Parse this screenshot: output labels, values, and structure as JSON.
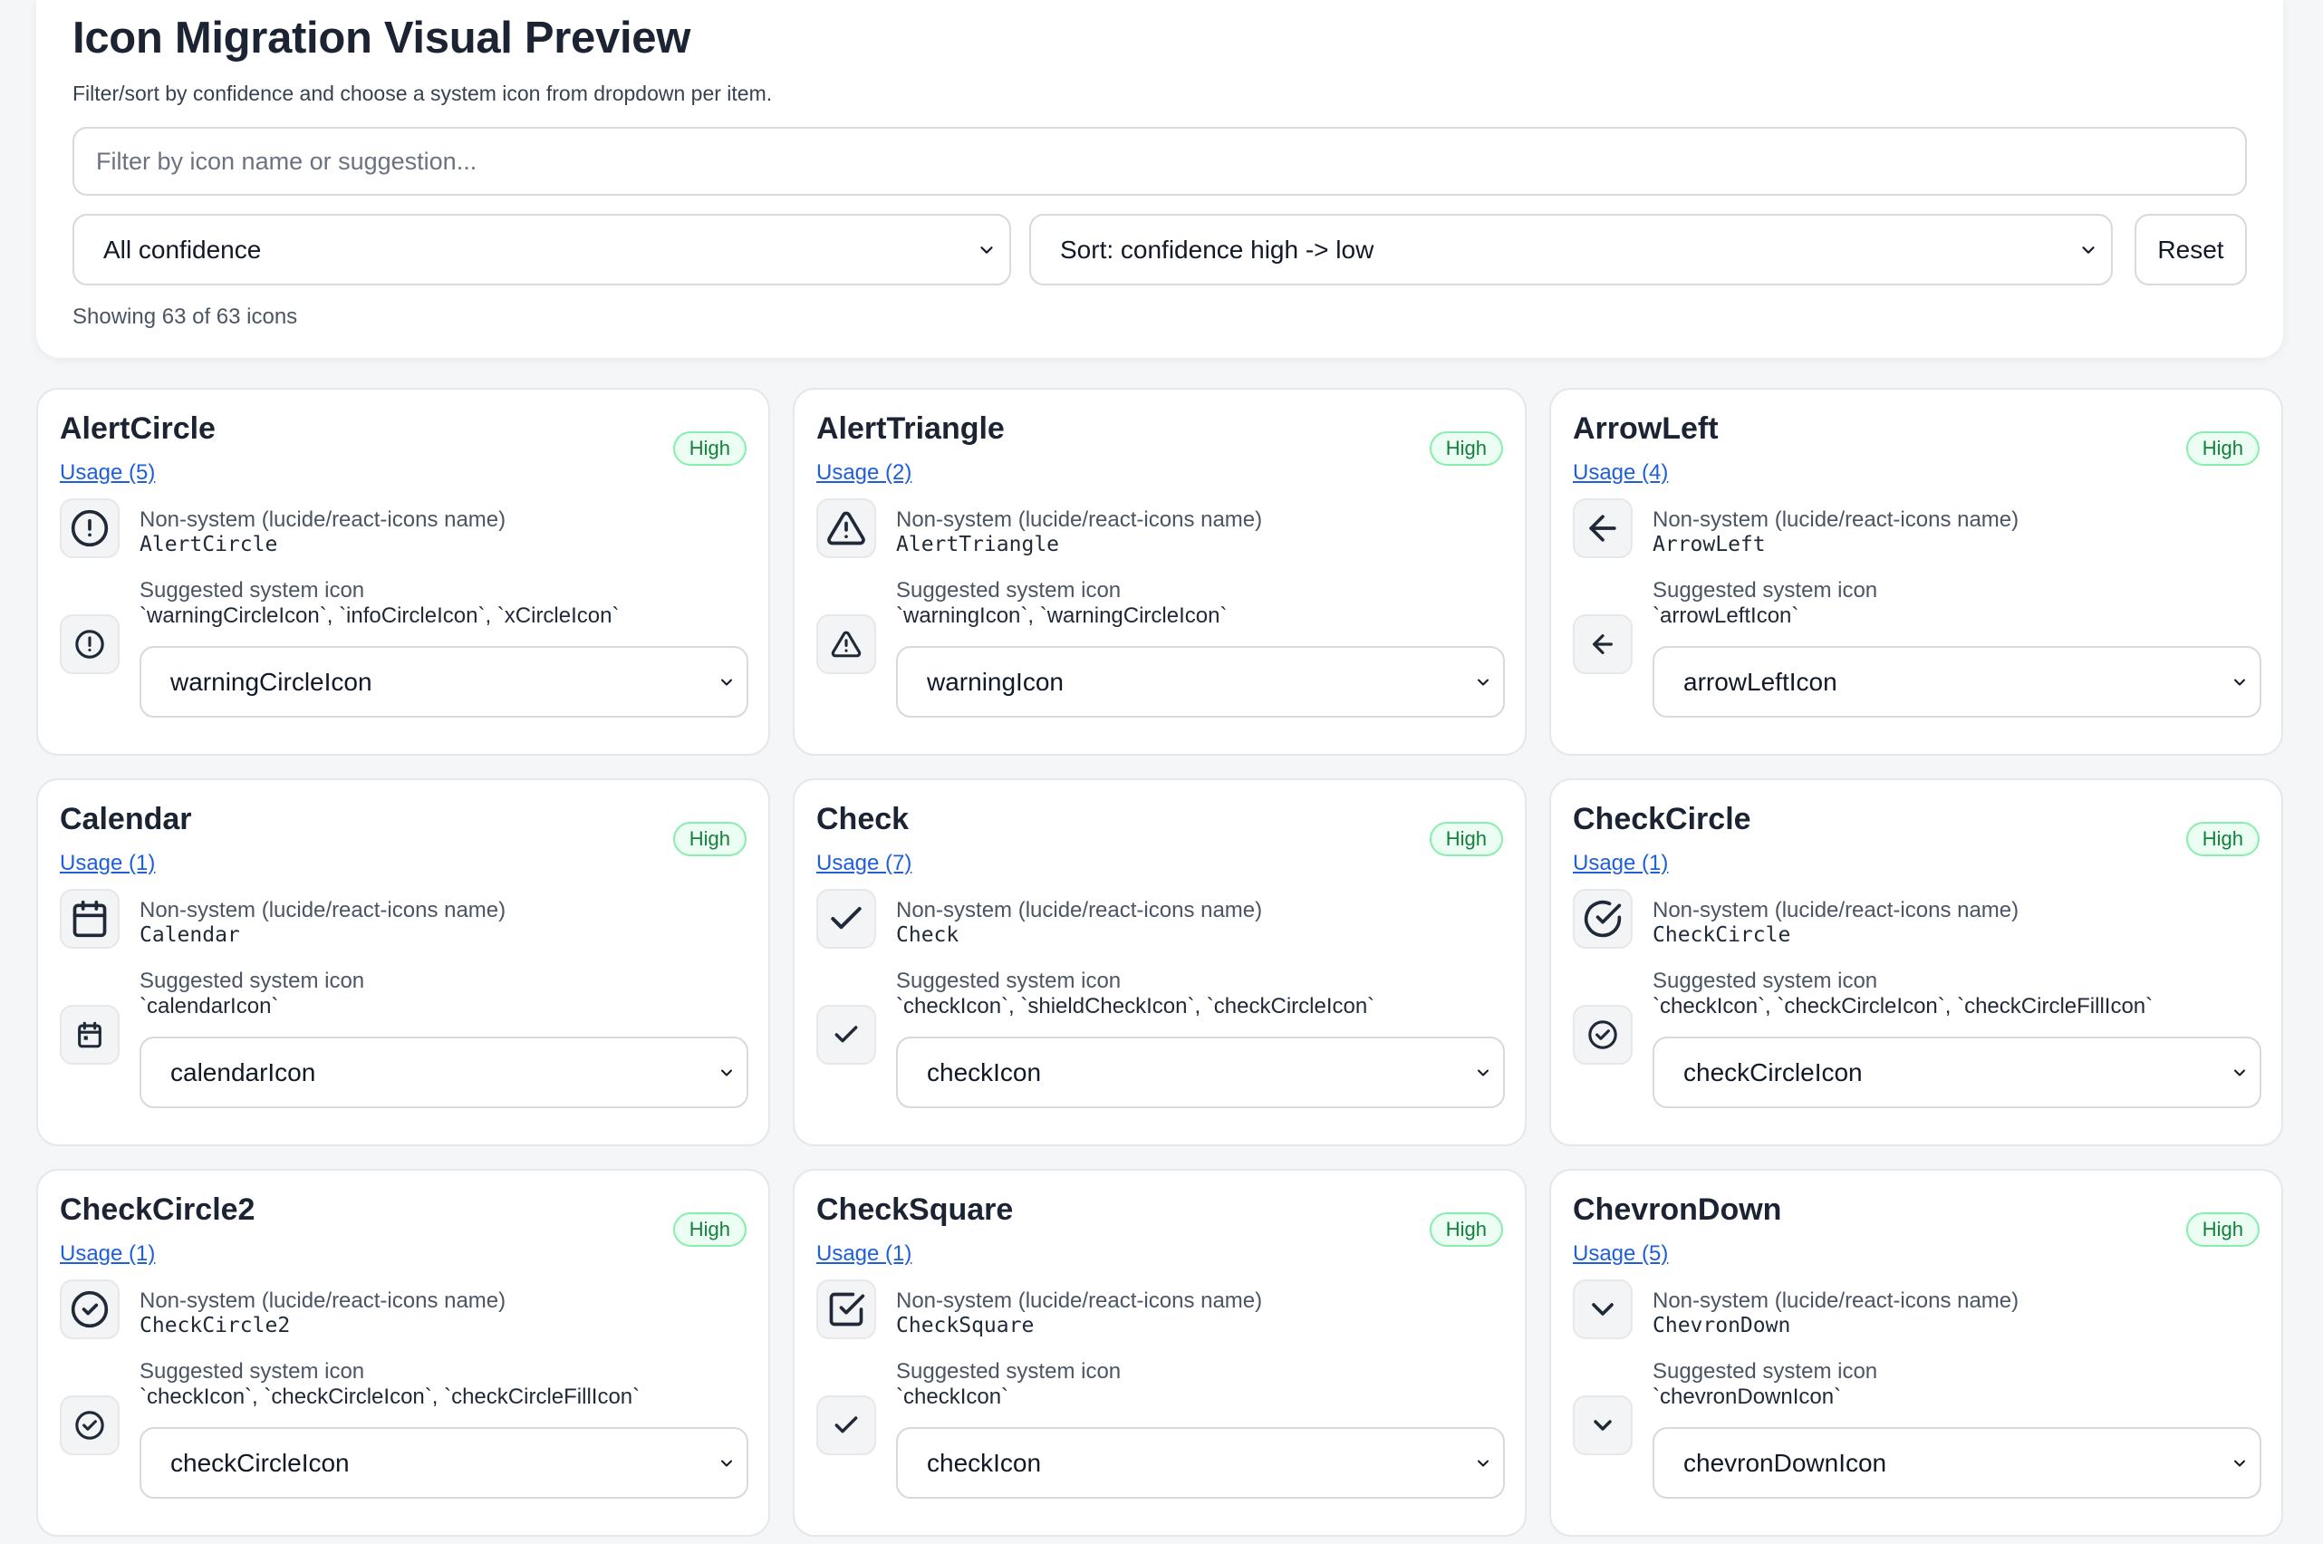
{
  "header": {
    "title": "Icon Migration Visual Preview",
    "subtitle": "Filter/sort by confidence and choose a system icon from dropdown per item.",
    "filter_placeholder": "Filter by icon name or suggestion...",
    "filter_value": "",
    "confidence_select": "All confidence",
    "sort_select": "Sort: confidence high -> low",
    "reset_label": "Reset",
    "count_text": "Showing 63 of 63 icons"
  },
  "labels": {
    "nonsystem": "Non-system (lucide/react-icons name)",
    "suggested": "Suggested system icon"
  },
  "colors": {
    "accent_link": "#1f5fd9",
    "badge_green": "#15803d",
    "badge_bg": "#ecfdf3"
  },
  "cards": [
    {
      "name": "AlertCircle",
      "usage": "Usage (5)",
      "confidence": "High",
      "icon": "alert-circle-icon",
      "suggestions": "`warningCircleIcon`, `infoCircleIcon`, `xCircleIcon`",
      "selected": "warningCircleIcon"
    },
    {
      "name": "AlertTriangle",
      "usage": "Usage (2)",
      "confidence": "High",
      "icon": "alert-triangle-icon",
      "suggestions": "`warningIcon`, `warningCircleIcon`",
      "selected": "warningIcon"
    },
    {
      "name": "ArrowLeft",
      "usage": "Usage (4)",
      "confidence": "High",
      "icon": "arrow-left-icon",
      "suggestions": "`arrowLeftIcon`",
      "selected": "arrowLeftIcon"
    },
    {
      "name": "Calendar",
      "usage": "Usage (1)",
      "confidence": "High",
      "icon": "calendar-icon",
      "suggestions": "`calendarIcon`",
      "selected": "calendarIcon"
    },
    {
      "name": "Check",
      "usage": "Usage (7)",
      "confidence": "High",
      "icon": "check-icon",
      "suggestions": "`checkIcon`, `shieldCheckIcon`, `checkCircleIcon`",
      "selected": "checkIcon"
    },
    {
      "name": "CheckCircle",
      "usage": "Usage (1)",
      "confidence": "High",
      "icon": "check-circle-icon",
      "suggestions": "`checkIcon`, `checkCircleIcon`, `checkCircleFillIcon`",
      "selected": "checkCircleIcon"
    },
    {
      "name": "CheckCircle2",
      "usage": "Usage (1)",
      "confidence": "High",
      "icon": "check-circle-2-icon",
      "suggestions": "`checkIcon`, `checkCircleIcon`, `checkCircleFillIcon`",
      "selected": "checkCircleIcon"
    },
    {
      "name": "CheckSquare",
      "usage": "Usage (1)",
      "confidence": "High",
      "icon": "check-square-icon",
      "suggestions": "`checkIcon`",
      "selected": "checkIcon"
    },
    {
      "name": "ChevronDown",
      "usage": "Usage (5)",
      "confidence": "High",
      "icon": "chevron-down-icon",
      "suggestions": "`chevronDownIcon`",
      "selected": "chevronDownIcon"
    }
  ]
}
